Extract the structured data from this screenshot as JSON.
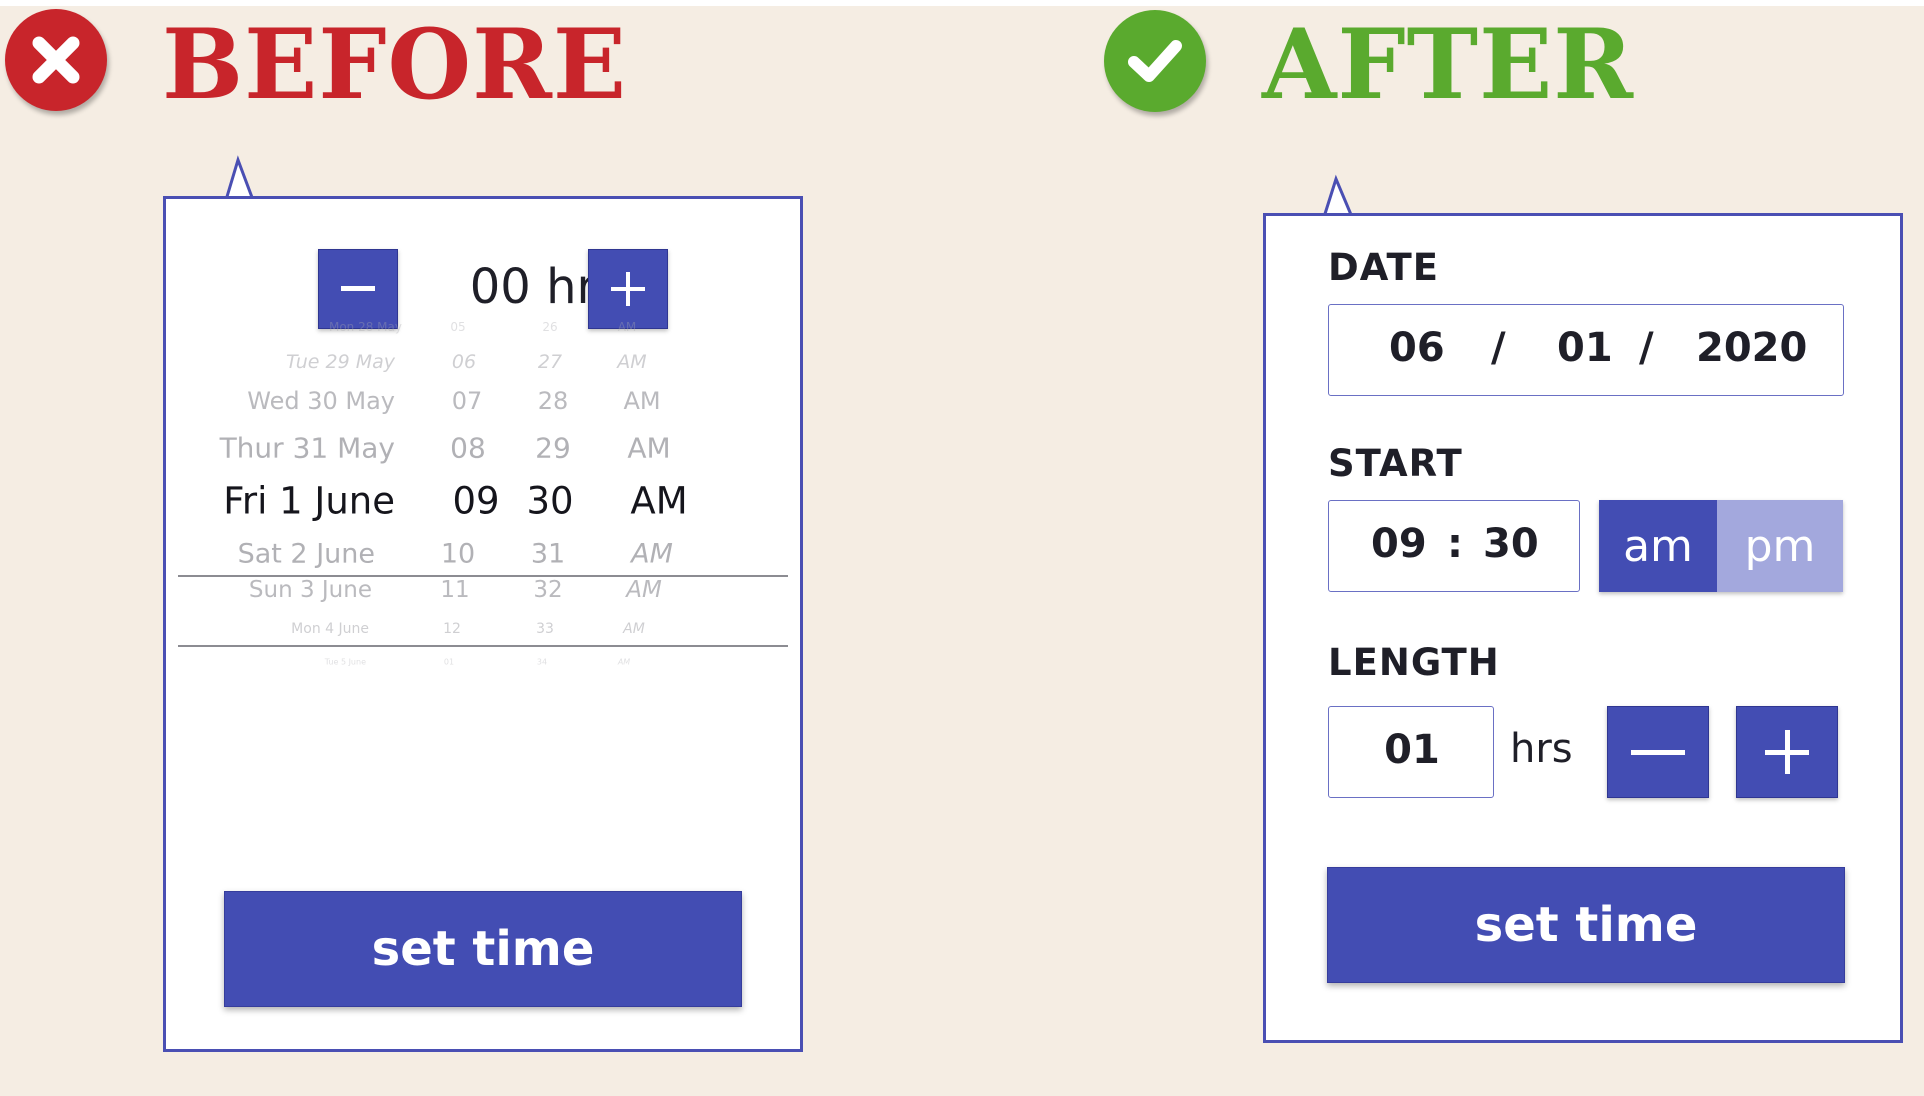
{
  "before": {
    "heading": "BEFORE",
    "status_icon": "x-icon",
    "hours_value": "00 hr",
    "wheel_rows": [
      {
        "date": "Mon 28 May",
        "hour": "05",
        "minute": "26",
        "period": "AM"
      },
      {
        "date": "Tue 29 May",
        "hour": "06",
        "minute": "27",
        "period": "AM"
      },
      {
        "date": "Wed 30 May",
        "hour": "07",
        "minute": "28",
        "period": "AM"
      },
      {
        "date": "Thur 31 May",
        "hour": "08",
        "minute": "29",
        "period": "AM"
      },
      {
        "date": "Fri 1 June",
        "hour": "09",
        "minute": "30",
        "period": "AM"
      },
      {
        "date": "Sat 2 June",
        "hour": "10",
        "minute": "31",
        "period": "AM"
      },
      {
        "date": "Sun 3 June",
        "hour": "11",
        "minute": "32",
        "period": "AM"
      },
      {
        "date": "Mon 4 June",
        "hour": "12",
        "minute": "33",
        "period": "AM"
      },
      {
        "date": "Tue 5 June",
        "hour": "01",
        "minute": "34",
        "period": "AM"
      }
    ],
    "set_time_label": "set time"
  },
  "after": {
    "heading": "AFTER",
    "status_icon": "check-icon",
    "date_label": "DATE",
    "date_month": "06",
    "date_sep_1": "/",
    "date_day": "01",
    "date_sep_2": "/",
    "date_year": "2020",
    "start_label": "START",
    "start_hour": "09",
    "start_colon": ":",
    "start_minute": "30",
    "am_label": "am",
    "pm_label": "pm",
    "length_label": "LENGTH",
    "length_value": "01",
    "length_unit": "hrs",
    "set_time_label": "set time"
  },
  "colors": {
    "accent": "#434db3",
    "accent_light": "#a3a8dd",
    "before": "#c8252b",
    "after": "#5aaa2e",
    "background": "#f5ede3"
  }
}
